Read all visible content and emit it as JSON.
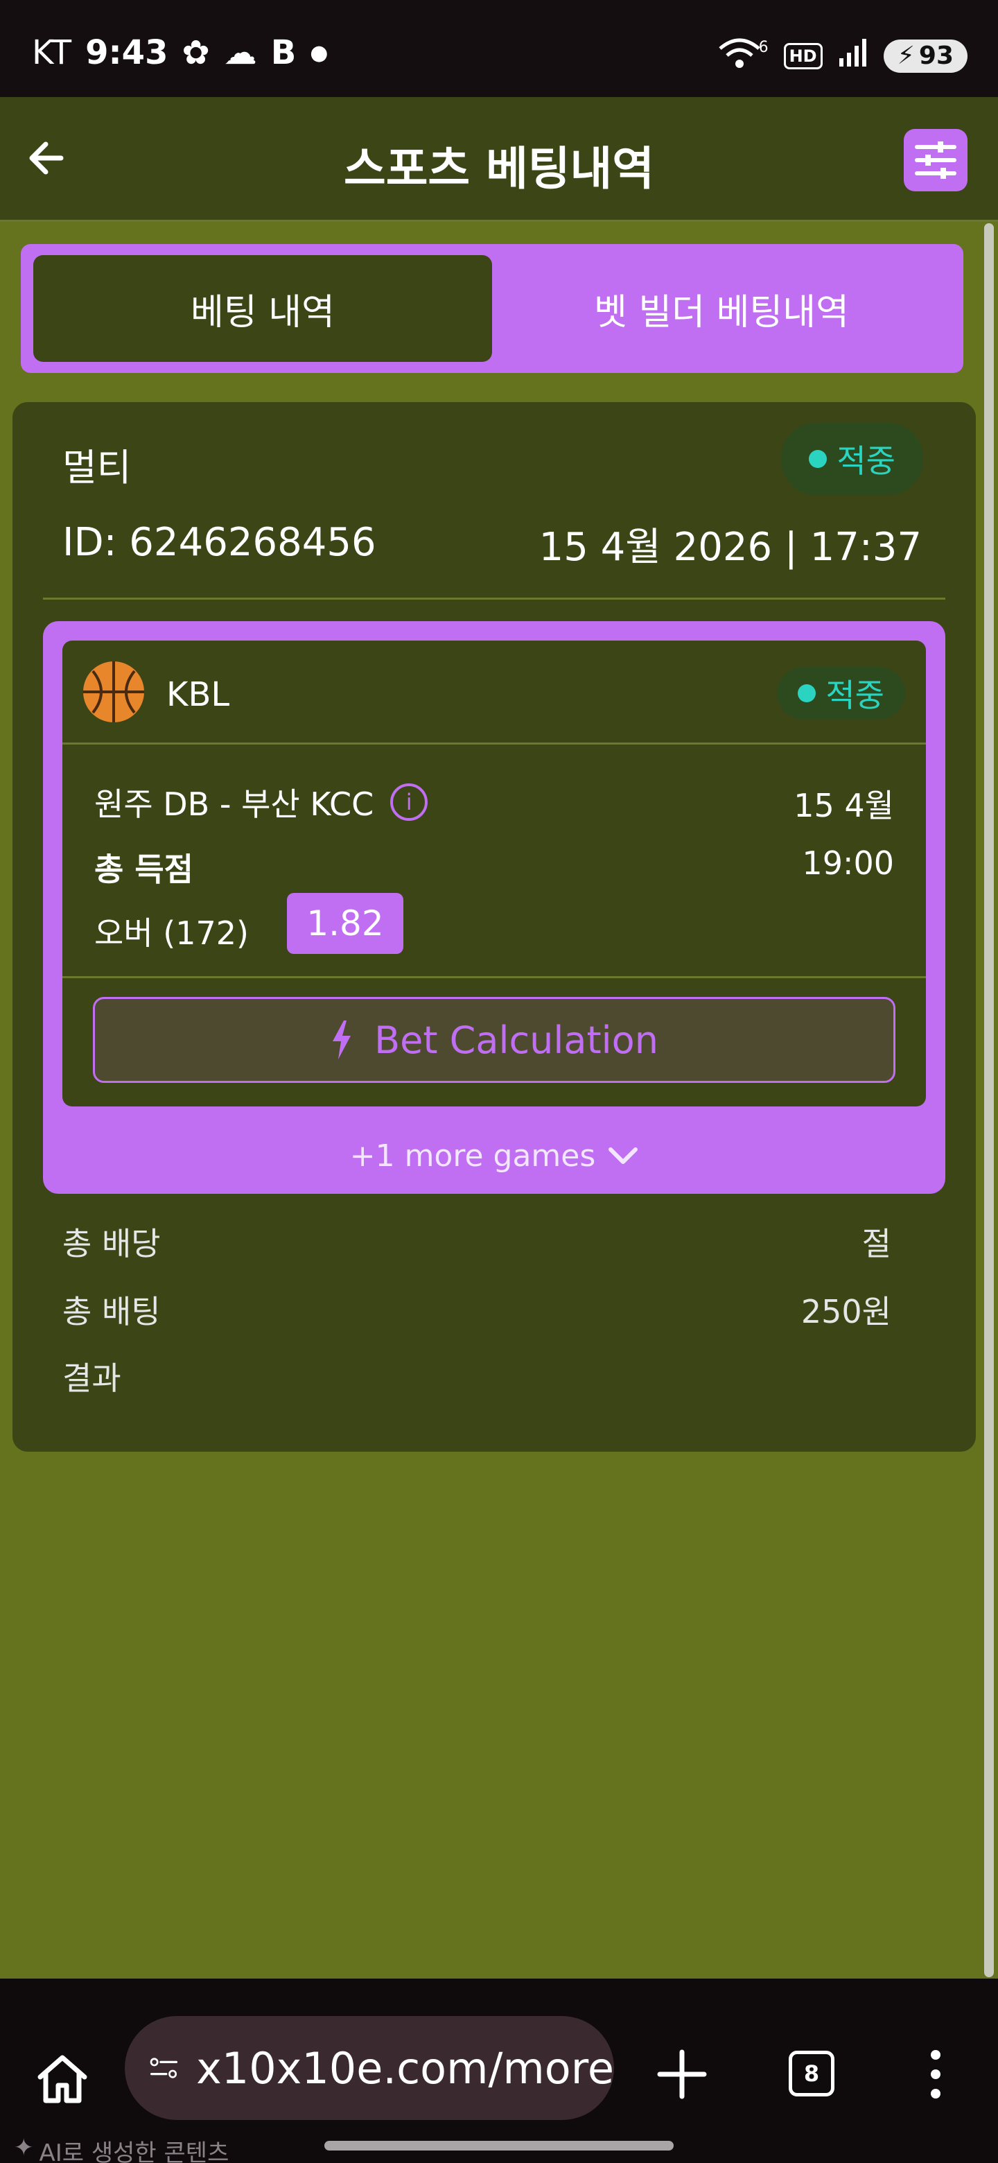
{
  "status_bar": {
    "carrier": "KT",
    "time": "9:43",
    "network": "6",
    "hd": "HD",
    "battery": "93"
  },
  "header": {
    "title": "스포츠 베팅내역"
  },
  "tabs": [
    {
      "label": "베팅 내역",
      "active": true
    },
    {
      "label": "벳 빌더 베팅내역",
      "active": false
    }
  ],
  "bet": {
    "type": "멀티",
    "status": "적중",
    "id": "ID: 6246268456",
    "date": "15 4월 2026 | 17:37",
    "selection": {
      "league": "KBL",
      "status": "적중",
      "match": "원주 DB - 부산 KCC",
      "match_date": "15 4월",
      "market": "총 득점",
      "match_time": "19:00",
      "pick": "오버 (172)",
      "odds": "1.82"
    },
    "calc_button": "Bet Calculation",
    "more_games": "+1 more games",
    "summary": [
      {
        "label": "총 배당",
        "value": "절"
      },
      {
        "label": "총 배팅",
        "value": "250원"
      },
      {
        "label": "결과",
        "value": ""
      }
    ]
  },
  "browser": {
    "url": "x10x10e.com/more",
    "tab_count": "8",
    "ai_note": "AI로 생성한 콘텐츠"
  },
  "colors": {
    "accent": "#c06ef2",
    "card_bg": "#3c4515",
    "page_bg": "#65731f",
    "win": "#2ad4c0"
  }
}
